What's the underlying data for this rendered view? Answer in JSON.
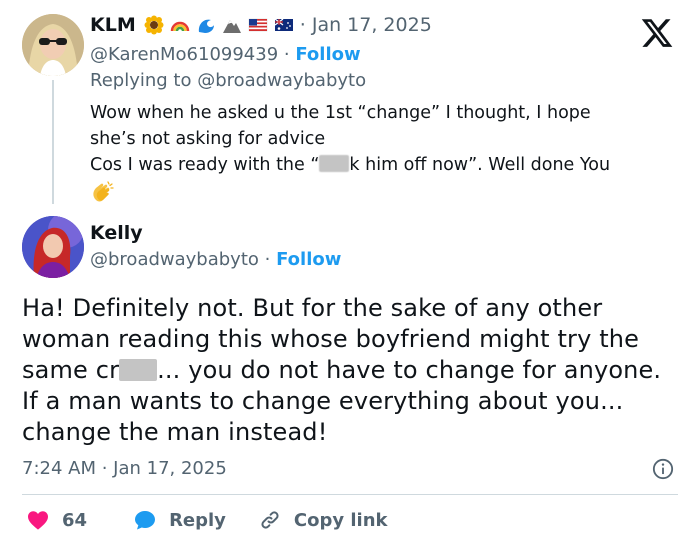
{
  "parent": {
    "name": "KLM",
    "date": "Jan 17, 2025",
    "handle": "@KarenMo61099439",
    "follow": "Follow",
    "replying_to": "Replying to @broadwaybabyto",
    "line1": "Wow when he asked u the 1st “change” I thought, I hope",
    "line2": "she’s not asking for advice",
    "line3_a": "Cos I was ready with the “",
    "line3_b": "k him off now”. Well done You",
    "emojis": [
      "sunflower-icon",
      "rainbow-icon",
      "wave-icon",
      "mountain-icon",
      "us-flag-icon",
      "australia-flag-icon",
      "clapping-hands-icon"
    ]
  },
  "reply": {
    "name": "Kelly",
    "handle": "@broadwaybabyto",
    "follow": "Follow",
    "text_a": "Ha! Definitely not. But for the sake of any other woman reading this whose boyfriend might try the same cr",
    "text_b": "... you do not have to change for anyone. If a man wants to change everything about you... change the man instead!",
    "timestamp": "7:24 AM · Jan 17, 2025"
  },
  "actions": {
    "likes": "64",
    "reply": "Reply",
    "copy_link": "Copy link"
  },
  "colors": {
    "accent": "#1d9bf0",
    "like": "#f91880",
    "muted": "#536471"
  }
}
